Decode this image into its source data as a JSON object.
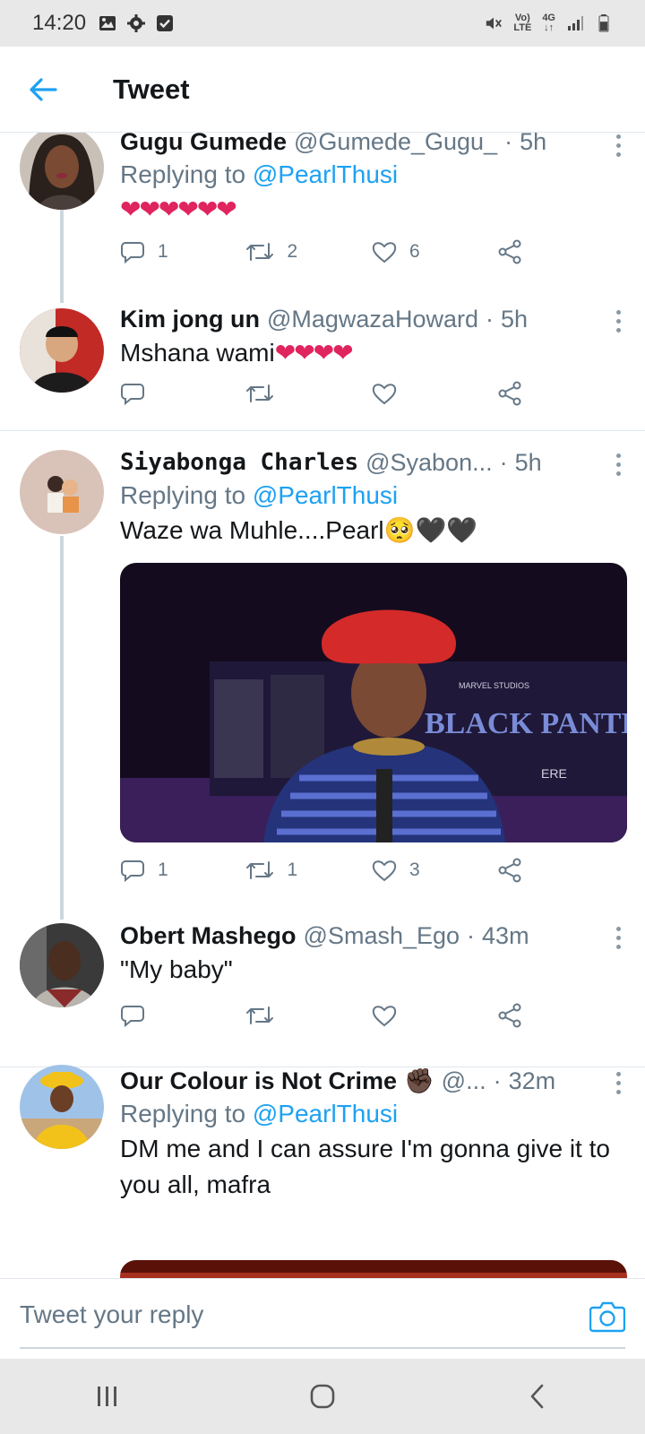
{
  "status_bar": {
    "time": "14:20",
    "volte_top": "Vo)",
    "volte_bottom": "LTE",
    "net_top": "4G",
    "net_bottom": "↓↑"
  },
  "header": {
    "title": "Tweet"
  },
  "colors": {
    "accent": "#1da1f2",
    "heart": "#e0245e",
    "secondary_text": "#657786"
  },
  "tweets": [
    {
      "name": "Gugu Gumede",
      "handle": "@Gumede_Gugu_",
      "sep": "·",
      "time": "5h",
      "replying_prefix": "Replying to",
      "mention": "@PearlThusi",
      "text": "",
      "emoji": "❤❤❤❤❤❤",
      "replies": "1",
      "retweets": "2",
      "likes": "6"
    },
    {
      "name": "Kim jong un",
      "handle": "@MagwazaHoward",
      "sep": "·",
      "time": "5h",
      "text": "Mshana wami",
      "emoji": "❤❤❤❤",
      "replies": "",
      "retweets": "",
      "likes": ""
    },
    {
      "name": "Siyabonga Charles",
      "handle": "@Syabon...",
      "sep": "·",
      "time": "5h",
      "replying_prefix": "Replying to",
      "mention": "@PearlThusi",
      "text": "Waze wa Muhle....Pearl",
      "emoji": "🥺🖤🖤",
      "media_caption_brand": "MARVEL STUDIOS",
      "media_caption_title": "BLACK PANTHER",
      "media_caption_sub": "ERE",
      "replies": "1",
      "retweets": "1",
      "likes": "3"
    },
    {
      "name": "Obert Mashego",
      "handle": "@Smash_Ego",
      "sep": "·",
      "time": "43m",
      "text": "\"My baby\"",
      "replies": "",
      "retweets": "",
      "likes": ""
    },
    {
      "name": "Our Colour is Not Crime",
      "name_emoji": "✊🏿",
      "handle": "@...",
      "sep": "·",
      "time": "32m",
      "replying_prefix": "Replying to",
      "mention": "@PearlThusi",
      "text": "DM me and I can assure I'm gonna give it to you all, mafra"
    }
  ],
  "composer": {
    "placeholder": "Tweet your reply"
  },
  "icons": {
    "back": "arrow-left-icon",
    "reply": "speech-bubble-icon",
    "retweet": "retweet-arrows-icon",
    "like": "heart-outline-icon",
    "share": "share-nodes-icon",
    "camera": "camera-icon",
    "nav_recents": "recents-icon",
    "nav_home": "home-icon",
    "nav_back": "back-chevron-icon"
  }
}
